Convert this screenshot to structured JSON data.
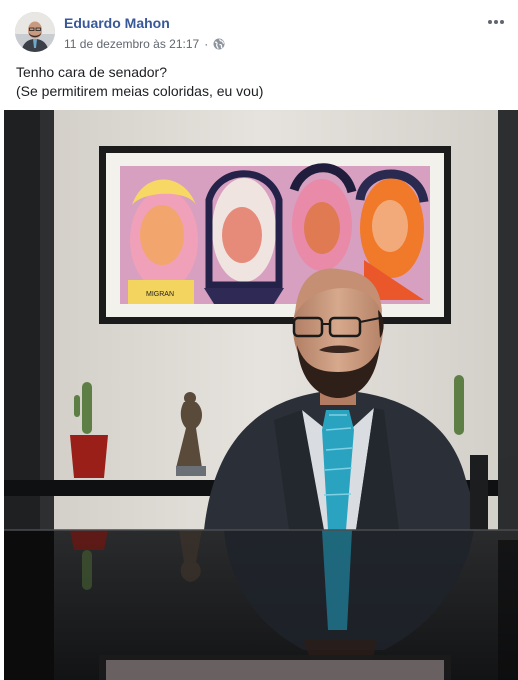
{
  "post": {
    "author": "Eduardo Mahon",
    "timestamp": "11 de dezembro às 21:17",
    "separator": "·",
    "privacy_icon": "globe-icon",
    "more_icon": "more-horizontal-icon",
    "caption_line1": "Tenho cara de senador?",
    "caption_line2": "(Se permitirem meias coloridas, eu vou)",
    "painting_signature": "MIGRAN"
  },
  "colors": {
    "author_link": "#385898",
    "meta_text": "#616770",
    "body_text": "#1c1e21"
  }
}
